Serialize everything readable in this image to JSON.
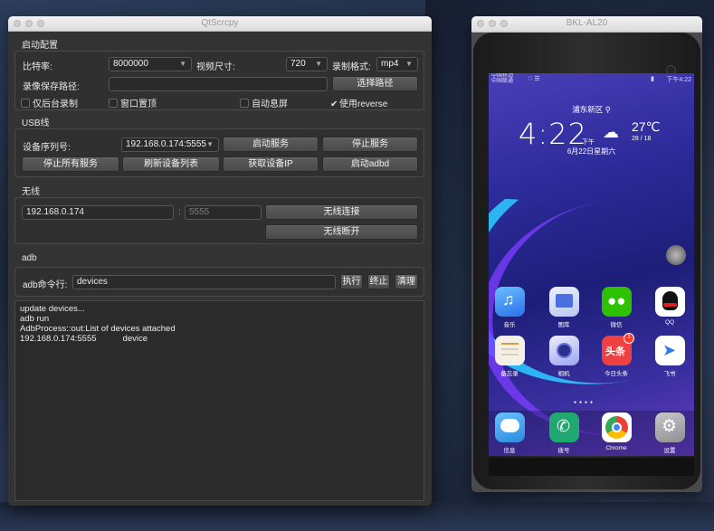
{
  "main_window": {
    "title": "QtScrcpy",
    "sections": {
      "config": "启动配置",
      "usb": "USB线",
      "wireless": "无线",
      "adb": "adb"
    },
    "config": {
      "bitrate_label": "比特率:",
      "bitrate_value": "8000000",
      "video_size_label": "视频尺寸:",
      "video_size_value": "720",
      "record_format_label": "录制格式:",
      "record_format_value": "mp4",
      "record_path_label": "录像保存路径:",
      "record_path_value": "",
      "select_path_button": "选择路径",
      "checkboxes": [
        {
          "label": "仅后台录制",
          "checked": false
        },
        {
          "label": "窗口置顶",
          "checked": false
        },
        {
          "label": "自动息屏",
          "checked": false
        },
        {
          "label": "使用reverse",
          "checked": true
        }
      ]
    },
    "usb": {
      "serial_label": "设备序列号:",
      "serial_value": "192.168.0.174:5555",
      "start_service": "启动服务",
      "stop_service": "停止服务",
      "stop_all": "停止所有服务",
      "refresh_devices": "刷新设备列表",
      "get_ip": "获取设备IP",
      "start_adbd": "启动adbd"
    },
    "wireless": {
      "ip_value": "192.168.0.174",
      "colon": ":",
      "port_placeholder": "5555",
      "connect": "无线连接",
      "disconnect": "无线断开"
    },
    "adb": {
      "cmd_label": "adb命令行:",
      "cmd_value": "devices",
      "execute": "执行",
      "terminate": "终止",
      "clear": "清理"
    },
    "log": [
      "update devices...",
      "adb run",
      "AdbProcess::out:List of devices attached",
      "192.168.0.174:5555           device"
    ]
  },
  "phone_window": {
    "title": "BKL-AL20",
    "status_left_1": "中国移动 ",
    "status_left_2": "中国联通",
    "status_right": "下午4:22",
    "location": "浦东新区",
    "time": "4:22",
    "ampm": "下午",
    "temperature": "27℃",
    "temp_range": "28 / 18",
    "date": "6月22日星期六",
    "apps_row1": [
      {
        "label": "音乐",
        "icon": "music-app-icon",
        "color": "#3a8ef0"
      },
      {
        "label": "图库",
        "icon": "gallery-app-icon",
        "color": "#4a6fe0"
      },
      {
        "label": "微信",
        "icon": "wechat-app-icon",
        "color": "#2dc100"
      },
      {
        "label": "QQ",
        "icon": "qq-app-icon",
        "color": "#ffffff"
      }
    ],
    "apps_row2": [
      {
        "label": "备忘录",
        "icon": "memo-app-icon",
        "color": "#f5f0e6"
      },
      {
        "label": "相机",
        "icon": "camera-app-icon",
        "color": "#6a74e0"
      },
      {
        "label": "今日头条",
        "icon": "toutiao-app-icon",
        "color": "#f04142",
        "badge": "1",
        "text": "头条"
      },
      {
        "label": "飞书",
        "icon": "feishu-app-icon",
        "color": "#ffffff"
      }
    ],
    "dock": [
      {
        "label": "信息",
        "icon": "messages-app-icon",
        "color": "#4aa8f0"
      },
      {
        "label": "拨号",
        "icon": "phone-app-icon",
        "color": "#1fa870"
      },
      {
        "label": "Chrome",
        "icon": "chrome-app-icon",
        "color": "#ffffff"
      },
      {
        "label": "设置",
        "icon": "settings-app-icon",
        "color": "#8e8e93"
      }
    ]
  }
}
